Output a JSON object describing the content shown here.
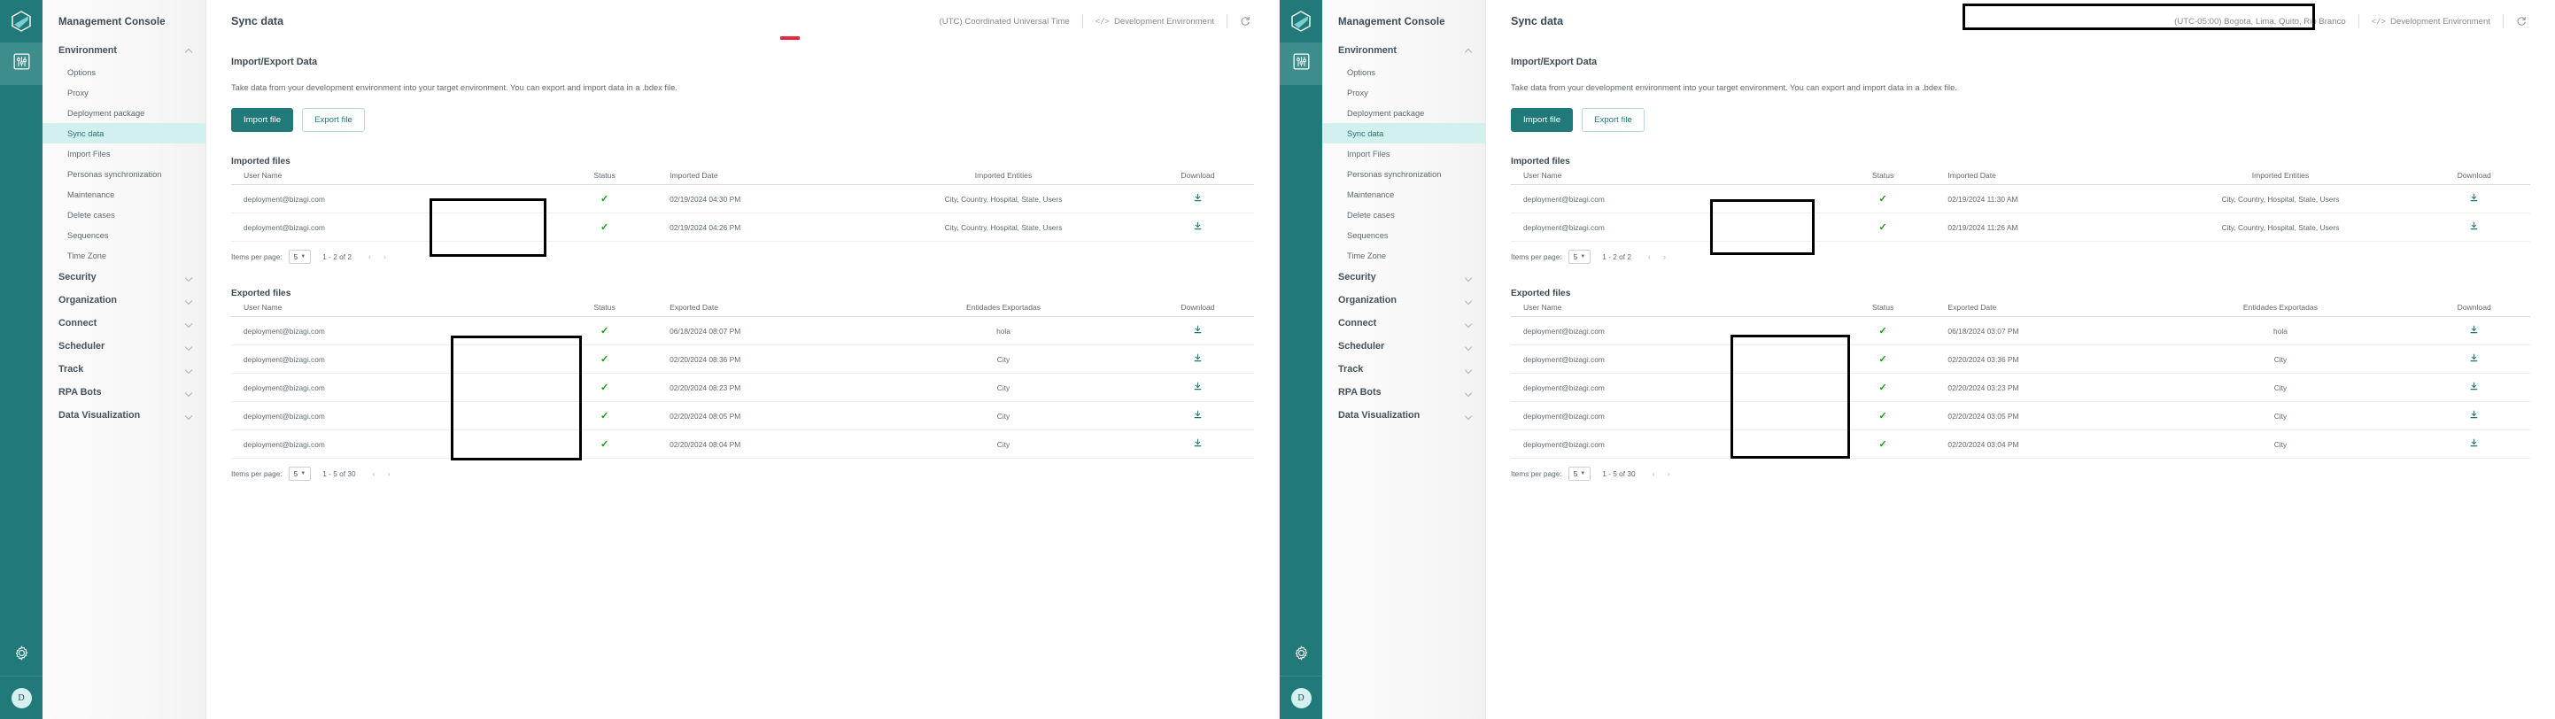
{
  "rail": {
    "logo_icon": "bizagi-hex-logo-icon",
    "items": [
      {
        "name": "management-console-icon",
        "icon": "sliders-icon",
        "active": true
      }
    ],
    "gear_icon": "gear-icon",
    "avatar_initial": "D"
  },
  "sidebar": {
    "title": "Management Console",
    "groups": [
      {
        "label": "Environment",
        "expanded": true,
        "chevron": "chevron-up-icon",
        "items": [
          {
            "label": "Options",
            "active": false
          },
          {
            "label": "Proxy",
            "active": false
          },
          {
            "label": "Deployment package",
            "active": false
          },
          {
            "label": "Sync data",
            "active": true
          },
          {
            "label": "Import Files",
            "active": false
          },
          {
            "label": "Personas synchronization",
            "active": false
          },
          {
            "label": "Maintenance",
            "active": false
          },
          {
            "label": "Delete cases",
            "active": false
          },
          {
            "label": "Sequences",
            "active": false
          },
          {
            "label": "Time Zone",
            "active": false
          }
        ]
      },
      {
        "label": "Security",
        "expanded": false,
        "chevron": "chevron-down-icon",
        "items": []
      },
      {
        "label": "Organization",
        "expanded": false,
        "chevron": "chevron-down-icon",
        "items": []
      },
      {
        "label": "Connect",
        "expanded": false,
        "chevron": "chevron-down-icon",
        "items": []
      },
      {
        "label": "Scheduler",
        "expanded": false,
        "chevron": "chevron-down-icon",
        "items": []
      },
      {
        "label": "Track",
        "expanded": false,
        "chevron": "chevron-down-icon",
        "items": []
      },
      {
        "label": "RPA Bots",
        "expanded": false,
        "chevron": "chevron-down-icon",
        "items": []
      },
      {
        "label": "Data Visualization",
        "expanded": false,
        "chevron": "chevron-down-icon",
        "items": []
      }
    ]
  },
  "common": {
    "page_title": "Sync data",
    "environment_label": "Development Environment",
    "env_code_icon": "code-brackets-icon",
    "refresh_icon": "refresh-icon",
    "section_title": "Import/Export Data",
    "section_desc": "Take data from your development environment into your target environment. You can export and import data in a .bdex file.",
    "import_button": "Import file",
    "export_button": "Export file",
    "imported_title": "Imported files",
    "exported_title": "Exported files",
    "imported_headers": [
      "User Name",
      "Status",
      "Imported Date",
      "Imported Entities",
      "Download"
    ],
    "exported_headers": [
      "User Name",
      "Status",
      "Exported Date",
      "Entidades Exportadas",
      "Download"
    ],
    "status_icon": "check-icon",
    "download_icon": "download-icon",
    "items_per_page_label": "Items per page:",
    "items_per_page_value": "5",
    "prev_icon": "chevron-left-icon",
    "next_icon": "chevron-right-icon",
    "accent_color": "#217a79",
    "active_nav_color": "#d2f0ee",
    "status_ok_color": "#13a10e",
    "highlight_box_color": "#000000",
    "red_mark_color": "#e5293e"
  },
  "left": {
    "timezone": "(UTC) Coordinated Universal Time",
    "imported_rows": [
      {
        "user": "deployment@bizagi.com",
        "status": "✓",
        "date": "02/19/2024 04:30 PM",
        "entities": "City, Country, Hospital, State, Users"
      },
      {
        "user": "deployment@bizagi.com",
        "status": "✓",
        "date": "02/19/2024 04:26 PM",
        "entities": "City, Country, Hospital, State, Users"
      }
    ],
    "imported_range": "1 - 2 of 2",
    "exported_rows": [
      {
        "user": "deployment@bizagi.com",
        "status": "✓",
        "date": "06/18/2024 08:07 PM",
        "entities": "hola"
      },
      {
        "user": "deployment@bizagi.com",
        "status": "✓",
        "date": "02/20/2024 08:36 PM",
        "entities": "City"
      },
      {
        "user": "deployment@bizagi.com",
        "status": "✓",
        "date": "02/20/2024 08:23 PM",
        "entities": "City"
      },
      {
        "user": "deployment@bizagi.com",
        "status": "✓",
        "date": "02/20/2024 08:05 PM",
        "entities": "City"
      },
      {
        "user": "deployment@bizagi.com",
        "status": "✓",
        "date": "02/20/2024 08:04 PM",
        "entities": "City"
      }
    ],
    "exported_range": "1 - 5 of 30"
  },
  "right": {
    "timezone": "(UTC-05:00) Bogota, Lima, Quito, Rio Branco",
    "imported_rows": [
      {
        "user": "deployment@bizagi.com",
        "status": "✓",
        "date": "02/19/2024 11:30 AM",
        "entities": "City, Country, Hospital, State, Users"
      },
      {
        "user": "deployment@bizagi.com",
        "status": "✓",
        "date": "02/19/2024 11:26 AM",
        "entities": "City, Country, Hospital, State, Users"
      }
    ],
    "imported_range": "1 - 2 of 2",
    "exported_rows": [
      {
        "user": "deployment@bizagi.com",
        "status": "✓",
        "date": "06/18/2024 03:07 PM",
        "entities": "hola"
      },
      {
        "user": "deployment@bizagi.com",
        "status": "✓",
        "date": "02/20/2024 03:36 PM",
        "entities": "City"
      },
      {
        "user": "deployment@bizagi.com",
        "status": "✓",
        "date": "02/20/2024 03:23 PM",
        "entities": "City"
      },
      {
        "user": "deployment@bizagi.com",
        "status": "✓",
        "date": "02/20/2024 03:05 PM",
        "entities": "City"
      },
      {
        "user": "deployment@bizagi.com",
        "status": "✓",
        "date": "02/20/2024 03:04 PM",
        "entities": "City"
      }
    ],
    "exported_range": "1 - 5 of 30"
  }
}
